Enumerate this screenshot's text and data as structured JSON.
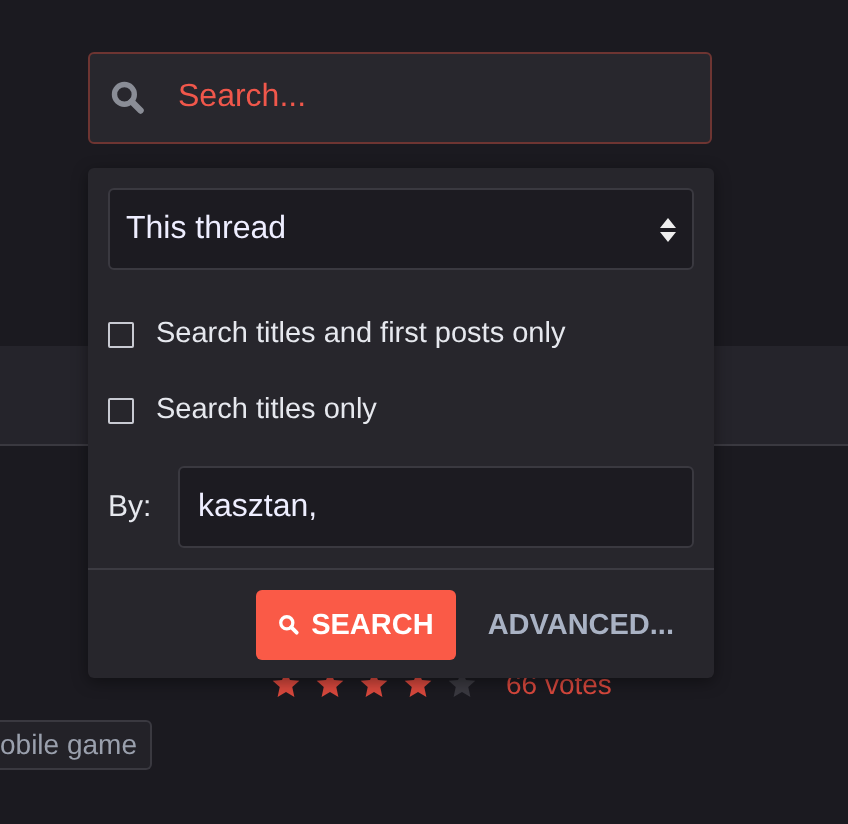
{
  "search": {
    "placeholder": "Search..."
  },
  "popup": {
    "scope": {
      "value": "This thread"
    },
    "options": [
      {
        "label": "Search titles and first posts only",
        "checked": false
      },
      {
        "label": "Search titles only",
        "checked": false
      }
    ],
    "by": {
      "label": "By:",
      "value": "kasztan,"
    },
    "buttons": [
      {
        "kind": "primary",
        "label": "SEARCH"
      },
      {
        "kind": "link",
        "label": "ADVANCED..."
      }
    ]
  },
  "rating": {
    "stars": 4,
    "votes": "66 votes"
  },
  "tag": "obile game"
}
